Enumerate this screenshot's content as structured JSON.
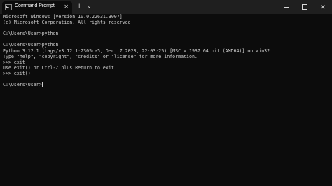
{
  "window": {
    "tab_title": "Command Prompt",
    "tab_close": "✕",
    "new_tab": "+",
    "dropdown": "⌄",
    "close": "✕"
  },
  "console": {
    "lines": [
      "Microsoft Windows [Version 10.0.22631.3007]",
      "(c) Microsoft Corporation. All rights reserved.",
      "",
      "C:\\Users\\User>python",
      "",
      "C:\\Users\\User>python",
      "Python 3.12.1 (tags/v3.12.1:2305ca5, Dec  7 2023, 22:03:25) [MSC v.1937 64 bit (AMD64)] on win32",
      "Type \"help\", \"copyright\", \"credits\" or \"license\" for more information.",
      ">>> exit",
      "Use exit() or Ctrl-Z plus Return to exit",
      ">>> exit()",
      "",
      "C:\\Users\\User>"
    ]
  },
  "colors": {
    "background": "#0c0c0c",
    "titlebar": "#1f1f1f",
    "text": "#cccccc"
  }
}
